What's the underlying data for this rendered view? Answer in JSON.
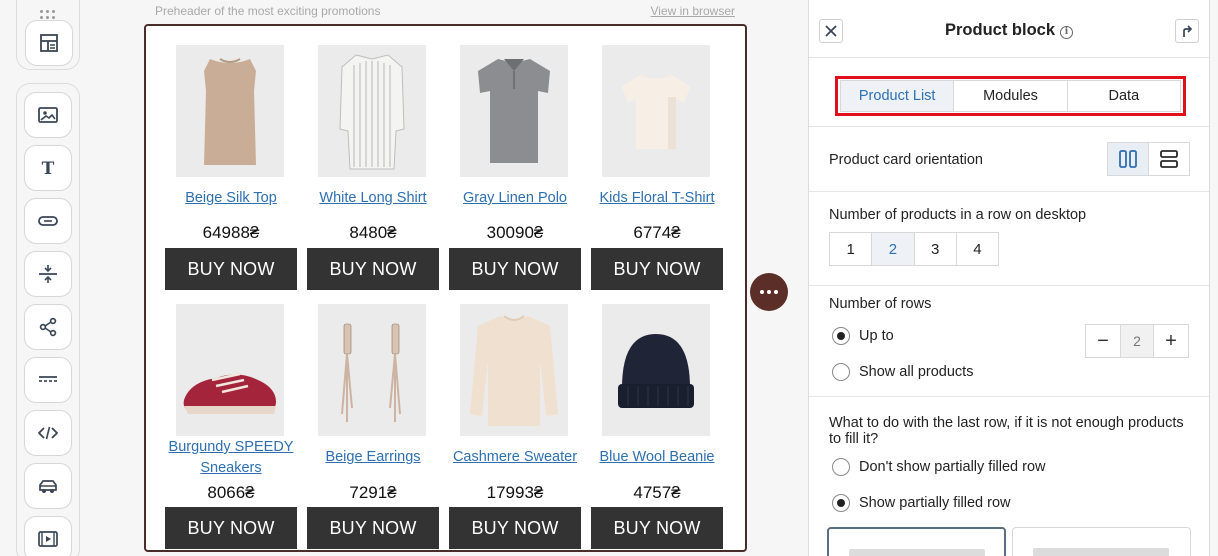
{
  "preheader": {
    "text": "Preheader of the most exciting promotions",
    "view_in_browser": "View in browser"
  },
  "toolbar": {
    "top_icon": "layout-template-icon",
    "tools": [
      "image-icon",
      "text-icon",
      "button-icon",
      "spacer-icon",
      "social-share-icon",
      "divider-icon",
      "html-code-icon",
      "product-icon",
      "video-icon"
    ]
  },
  "products": [
    {
      "name": "Beige Silk Top",
      "price": "64988₴",
      "cta": "BUY NOW"
    },
    {
      "name": "White Long Shirt",
      "price": "8480₴",
      "cta": "BUY NOW"
    },
    {
      "name": "Gray Linen Polo",
      "price": "30090₴",
      "cta": "BUY NOW"
    },
    {
      "name": "Kids Floral T-Shirt",
      "price": "6774₴",
      "cta": "BUY NOW"
    },
    {
      "name": "Burgundy SPEEDY Sneakers",
      "price": "8066₴",
      "cta": "BUY NOW"
    },
    {
      "name": "Beige Earrings",
      "price": "7291₴",
      "cta": "BUY NOW"
    },
    {
      "name": "Cashmere Sweater",
      "price": "17993₴",
      "cta": "BUY NOW"
    },
    {
      "name": "Blue Wool Beanie",
      "price": "4757₴",
      "cta": "BUY NOW"
    }
  ],
  "panel": {
    "title": "Product block",
    "info": "i",
    "tabs": [
      {
        "label": "Product List",
        "active": true
      },
      {
        "label": "Modules",
        "active": false
      },
      {
        "label": "Data",
        "active": false
      }
    ],
    "orientation_label": "Product card orientation",
    "per_row_label": "Number of products in a row on desktop",
    "per_row_options": [
      "1",
      "2",
      "3",
      "4"
    ],
    "per_row_selected": "2",
    "rows_label": "Number of rows",
    "rows_up_to": "Up to",
    "rows_show_all": "Show all products",
    "rows_value": "2",
    "stepper_minus": "−",
    "stepper_plus": "+",
    "last_row_label": "What to do with the last row, if it is not enough products to fill it?",
    "last_row_opt1": "Don't show partially filled row",
    "last_row_opt2": "Show partially filled row"
  },
  "colors": {
    "accent_link": "#2d6fb1",
    "buy_button": "#333333",
    "canvas_border": "#4a2c2a",
    "highlight": "#e0101a",
    "more_button": "#5b2f28"
  }
}
